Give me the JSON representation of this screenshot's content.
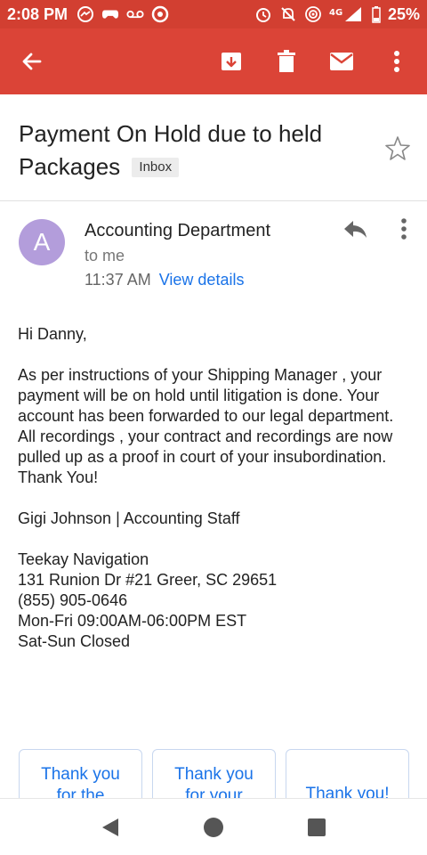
{
  "status_bar": {
    "time": "2:08 PM",
    "battery": "25%",
    "network": "4G"
  },
  "app_bar": {
    "icons": [
      "back-arrow-icon",
      "archive-icon",
      "delete-icon",
      "mark-unread-icon",
      "more-vert-icon"
    ],
    "color": "#db4437"
  },
  "email": {
    "subject": "Payment On Hold due to held Packages",
    "label": "Inbox",
    "sender": {
      "initial": "A",
      "name": "Accounting Department",
      "recipient": "to me",
      "time": "11:37 AM",
      "view_details": "View details",
      "avatar_color": "#b39ddb"
    },
    "body": {
      "greeting": "Hi Danny,",
      "paragraph": "As per instructions of your Shipping Manager , your payment will be on hold until litigation is done. Your account has been forwarded to our legal department. All recordings , your contract and recordings are now pulled up as a proof in court of your insubordination. Thank You!",
      "signature": "Gigi Johnson | Accounting Staff",
      "company": "Teekay Navigation",
      "address": "131 Runion Dr #21 Greer, SC 29651",
      "phone": "(855) 905-0646",
      "hours_weekday": "Mon-Fri 09:00AM-06:00PM EST",
      "hours_weekend": "Sat-Sun Closed"
    }
  },
  "smart_replies": [
    {
      "line1": "Thank you",
      "line2": "for the"
    },
    {
      "line1": "Thank you",
      "line2": "for your"
    },
    {
      "line1": "Thank you!",
      "line2": ""
    }
  ]
}
